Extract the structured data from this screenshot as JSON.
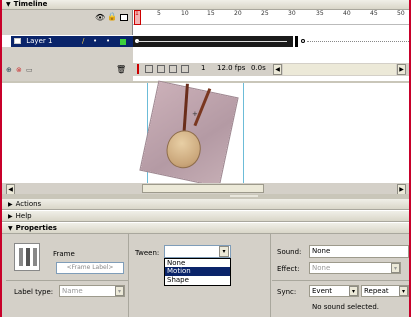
{
  "timeline": {
    "title": "Timeline",
    "layer_name": "Layer 1",
    "ruler_numbers": [
      "1",
      "5",
      "10",
      "15",
      "20",
      "25",
      "30",
      "35",
      "40",
      "45",
      "50"
    ],
    "current_frame": "1",
    "frame_rate": "12.0 fps",
    "elapsed_time": "0.0s"
  },
  "panels": {
    "actions": "Actions",
    "help": "Help",
    "properties": "Properties"
  },
  "properties": {
    "frame_label": "Frame",
    "frame_placeholder": "<Frame Label>",
    "label_type_label": "Label type:",
    "label_type_value": "Name",
    "tween_label": "Tween:",
    "tween_options": [
      "None",
      "Motion",
      "Shape"
    ],
    "tween_selected": "Motion",
    "sound_label": "Sound:",
    "sound_value": "None",
    "effect_label": "Effect:",
    "effect_value": "None",
    "sync_label": "Sync:",
    "sync_value": "Event",
    "repeat_value": "Repeat",
    "repeat_count": "1",
    "sound_status": "No sound selected."
  },
  "colors": {
    "frame_border": "#c8002a",
    "selected_layer": "#0a246a",
    "selected_option": "#0a246a",
    "panel_bg": "#d4d0c8",
    "stage_bg": "#ffffff"
  }
}
